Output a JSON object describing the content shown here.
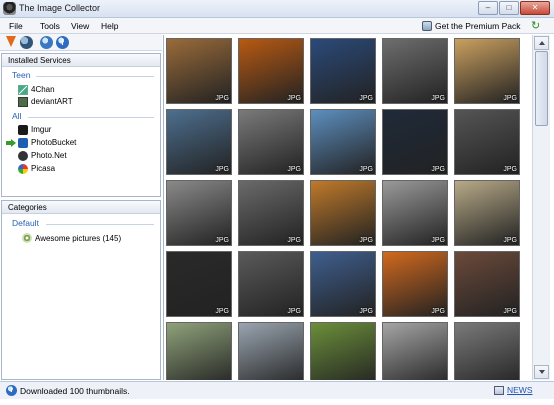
{
  "window": {
    "title": "The Image Collector",
    "minimize": "–",
    "maximize": "□",
    "close": "✕"
  },
  "menu": {
    "file": "File",
    "tools": "Tools",
    "view": "View",
    "help": "Help",
    "premium": "Get the Premium Pack"
  },
  "toolbar": {
    "info_glyph": "i"
  },
  "services": {
    "header": "Installed Services",
    "groups": [
      {
        "label": "Teen",
        "items": [
          {
            "label": "4Chan",
            "icon": "4chan-icon"
          },
          {
            "label": "deviantART",
            "icon": "deviantart-icon"
          }
        ]
      },
      {
        "label": "All",
        "items": [
          {
            "label": "Imgur",
            "icon": "imgur-icon"
          },
          {
            "label": "PhotoBucket",
            "icon": "photobucket-icon",
            "selected": true
          },
          {
            "label": "Photo.Net",
            "icon": "photonet-icon"
          },
          {
            "label": "Picasa",
            "icon": "picasa-icon"
          }
        ]
      }
    ]
  },
  "categories": {
    "header": "Categories",
    "group": "Default",
    "item": "Awesome pictures (145)"
  },
  "thumbnail_badge": "JPG",
  "thumbnails": [
    "#9a6b3a",
    "#b85a12",
    "#2b4a7a",
    "#6e6e6e",
    "#caa060",
    "#4d6f8f",
    "#7a7a7a",
    "#5d8fbf",
    "#1f2a3a",
    "#555555",
    "#8a8a8a",
    "#6a6a6a",
    "#c07a2a",
    "#9a9a9a",
    "#b8aa88",
    "#2a2a2a",
    "#5a5a5a",
    "#3f5f8f",
    "#d2691e",
    "#6b4a3a",
    "#8fa27a",
    "#9aa5b0",
    "#6b8f3a",
    "#a5a5a5",
    "#7a7a7a"
  ],
  "status": {
    "text": "Downloaded 100 thumbnails.",
    "info_glyph": "i",
    "news": "NEWS"
  }
}
